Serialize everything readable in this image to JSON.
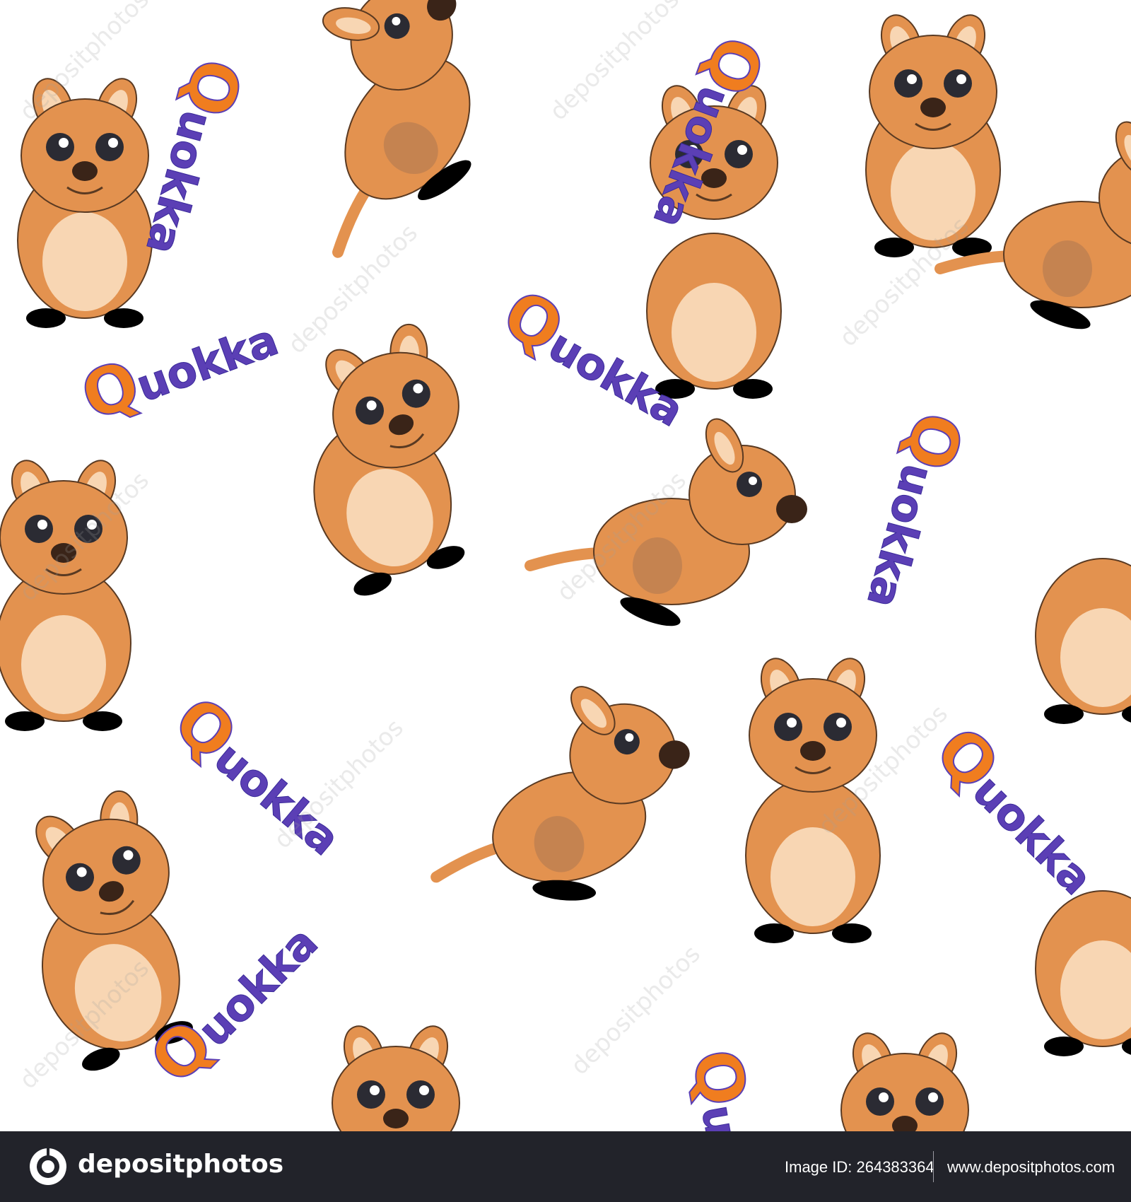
{
  "pattern": {
    "word": {
      "first": "Q",
      "rest": "uokka"
    },
    "watermark_text": "depositphotos",
    "colors": {
      "fur": "#e3924f",
      "fur_outline": "#5a3a22",
      "belly": "#f8d6b3",
      "shade": "#b07a52",
      "feet": "#000000",
      "nose": "#3a2418",
      "eye": "#2b2b33",
      "text_orange": "#f07d1f",
      "text_purple": "#5b3fb5"
    },
    "quokka_count": 13,
    "word_count": 11
  },
  "footer": {
    "brand": "depositphotos",
    "image_id": "Image ID: 264383364",
    "url": "www.depositphotos.com",
    "background": "#22232a"
  }
}
